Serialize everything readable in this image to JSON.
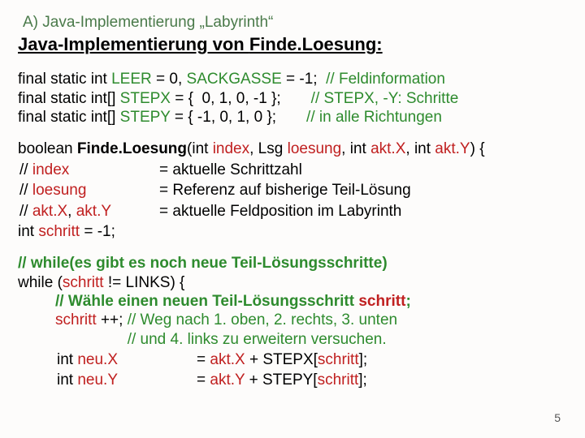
{
  "header": "A) Java-Implementierung „Labyrinth“",
  "title_a": "Java-Implementierung von ",
  "title_b": "Finde.Loesung:",
  "decl": {
    "l1a": "final static int ",
    "l1b": "LEER",
    "l1c": " = 0, ",
    "l1d": "SACKGASSE",
    "l1e": " = -1;  ",
    "l1cm": "// Feldinformation",
    "l2a": "final static int[] ",
    "l2b": "STEPX",
    "l2c": " = {  0, 1, 0, -1 };       ",
    "l2cm": "// STEPX, -Y: Schritte",
    "l3a": "final static int[] ",
    "l3b": "STEPY",
    "l3c": " = { -1, 0, 1, 0 };       ",
    "l3cm": "// in alle Richtungen"
  },
  "sig": {
    "a": "boolean ",
    "fn": "Finde.Loesung",
    "b": "(int ",
    "p1": "index",
    "c": ", Lsg ",
    "p2": "loesung",
    "d": ", int ",
    "p3": "akt.X",
    "e": ", int ",
    "p4": "akt.Y",
    "f": ") {"
  },
  "params": {
    "r1a": "// ",
    "r1b": "index",
    "r1c": "= aktuelle Schrittzahl",
    "r2a": "// ",
    "r2b": "loesung",
    "r2c": "= Referenz auf bisherige Teil-Lösung",
    "r3a": "// ",
    "r3b": "akt.X",
    ", ": "",
    "r3b2": "akt.Y",
    "r3c": "= aktuelle Feldposition im Labyrinth",
    "ivar_a": "int ",
    "ivar_b": "schritt",
    "ivar_c": " = -1;"
  },
  "body": {
    "c1": "// while(es gibt es noch neue Teil-Lösungsschritte)",
    "w1a": "while (",
    "w1b": "schritt",
    "w1c": " != LINKS) {",
    "c2a": "// Wähle einen neuen Teil-Lösungsschritt ",
    "c2b": "schritt",
    "c2c": ";",
    "s1a": "schritt",
    "s1b": " ++; ",
    "s1cm": "// Weg nach 1. oben, 2. rechts, 3. unten",
    "s2cm": "// und 4. links zu erweitern versuchen.",
    "n1a": "int ",
    "n1b": "neu.X",
    "eq": "= ",
    "n1c": "akt.X",
    "n1d": " + STEPX[",
    "n1e": "schritt",
    "n1f": "];",
    "n2a": "int ",
    "n2b": "neu.Y",
    "n2c": "akt.Y",
    "n2d": " + STEPY[",
    "n2e": "schritt",
    "n2f": "];"
  },
  "page": "5"
}
